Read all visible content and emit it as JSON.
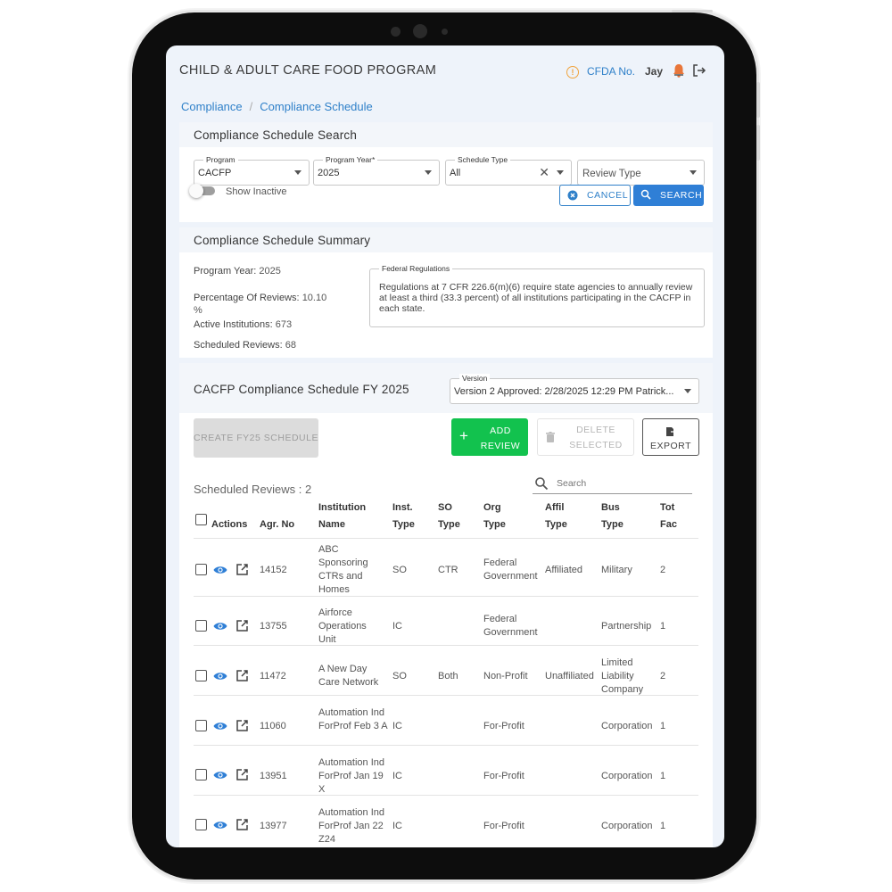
{
  "header": {
    "app_title": "CHILD & ADULT CARE FOOD PROGRAM",
    "cfda_label": "CFDA No.",
    "user_name": "Jay"
  },
  "breadcrumb": {
    "root": "Compliance",
    "separator": "/",
    "current": "Compliance Schedule"
  },
  "search_panel": {
    "title": "Compliance Schedule Search",
    "program": {
      "label": "Program",
      "value": "CACFP"
    },
    "program_year": {
      "label": "Program Year*",
      "value": "2025"
    },
    "schedule_type": {
      "label": "Schedule Type",
      "value": "All"
    },
    "review_type": {
      "placeholder": "Review Type"
    },
    "show_inactive_label": "Show Inactive",
    "show_inactive_on": false,
    "cancel_label": "CANCEL",
    "search_label": "SEARCH"
  },
  "summary": {
    "title": "Compliance Schedule Summary",
    "program_year_label": "Program Year:",
    "program_year_value": "2025",
    "percentage_label": "Percentage Of Reviews:",
    "percentage_value": "10.10",
    "percentage_unit": "%",
    "active_label": "Active Institutions:",
    "active_value": "673",
    "scheduled_label": "Scheduled Reviews:",
    "scheduled_value": "68",
    "fed_reg_label": "Federal Regulations",
    "fed_reg_text": "Regulations at 7 CFR 226.6(m)(6) require state agencies to annually review at least a third (33.3 percent) of all institutions participating in the CACFP in each state."
  },
  "schedule": {
    "title": "CACFP Compliance Schedule FY 2025",
    "version_label": "Version",
    "version_value": "Version 2 Approved: 2/28/2025 12:29 PM Patrick...",
    "create_label": "CREATE FY25 SCHEDULE",
    "add_label": "ADD REVIEW",
    "delete_label": "DELETE SELECTED",
    "export_label": "EXPORT",
    "count_text": "Scheduled Reviews : 2",
    "search_placeholder": "Search",
    "columns": [
      "Actions",
      "Agr. No",
      "Institution Name",
      "Inst. Type",
      "SO Type",
      "Org Type",
      "Affil Type",
      "Bus Type",
      "Tot Fac"
    ],
    "rows": [
      {
        "agr": "14152",
        "name": "ABC Sponsoring CTRs and Homes",
        "inst": "SO",
        "so": "CTR",
        "org": "Federal Government",
        "affil": "Affiliated",
        "bus": "Military",
        "tot": "2"
      },
      {
        "agr": "13755",
        "name": "Airforce Operations Unit",
        "inst": "IC",
        "so": "",
        "org": "Federal Government",
        "affil": "",
        "bus": "Partnership",
        "tot": "1"
      },
      {
        "agr": "11472",
        "name": "A New Day Care Network",
        "inst": "SO",
        "so": "Both",
        "org": "Non-Profit",
        "affil": "Unaffiliated",
        "bus": "Limited Liability Company",
        "tot": "2"
      },
      {
        "agr": "11060",
        "name": "Automation Ind ForProf Feb 3 A",
        "inst": "IC",
        "so": "",
        "org": "For-Profit",
        "affil": "",
        "bus": "Corporation",
        "tot": "1"
      },
      {
        "agr": "13951",
        "name": "Automation Ind ForProf Jan 19 X",
        "inst": "IC",
        "so": "",
        "org": "For-Profit",
        "affil": "",
        "bus": "Corporation",
        "tot": "1"
      },
      {
        "agr": "13977",
        "name": "Automation Ind ForProf Jan 22 Z24",
        "inst": "IC",
        "so": "",
        "org": "For-Profit",
        "affil": "",
        "bus": "Corporation",
        "tot": "1"
      }
    ]
  },
  "colors": {
    "accent": "#2f80c9",
    "add_green": "#12c24e",
    "warning": "#f0a23a"
  }
}
